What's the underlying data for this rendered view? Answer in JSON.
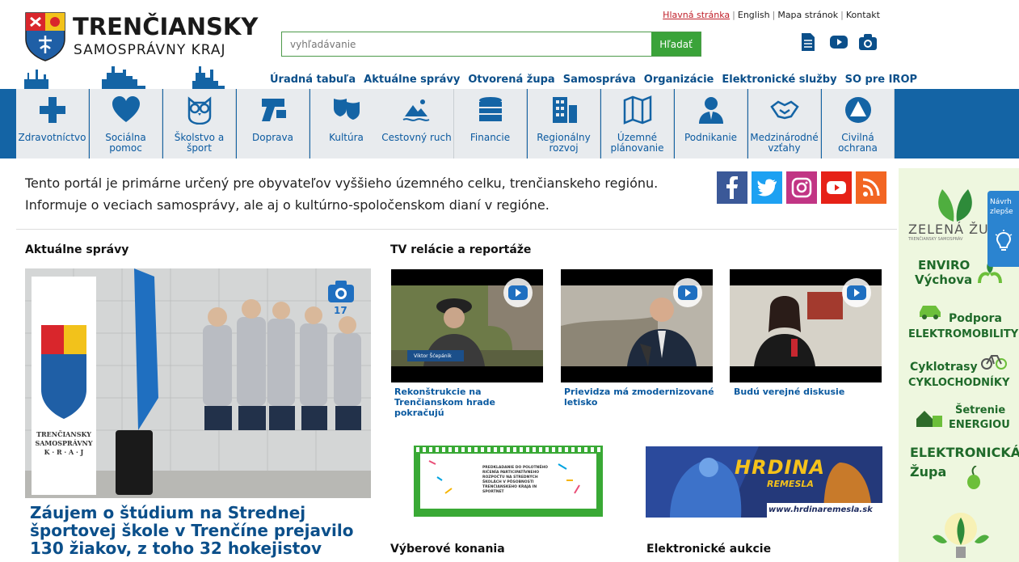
{
  "header": {
    "logo_line1": "TRENČIANSKY",
    "logo_line2": "SAMOSPRÁVNY KRAJ",
    "top_links": [
      "Hlavná stránka",
      "English",
      "Mapa stránok",
      "Kontakt"
    ],
    "search_placeholder": "vyhľadávanie",
    "search_button": "Hľadať",
    "icons": [
      "document-icon",
      "youtube-icon",
      "camera-icon"
    ]
  },
  "main_nav": [
    "Úradná tabuľa",
    "Aktuálne správy",
    "Otvorená župa",
    "Samospráva",
    "Organizácie",
    "Elektronické služby",
    "SO pre IROP"
  ],
  "categories": [
    {
      "label": "Zdravotníctvo",
      "icon": "cross-icon"
    },
    {
      "label": "Sociálna pomoc",
      "icon": "heart-icon"
    },
    {
      "label": "Školstvo a šport",
      "icon": "owl-icon"
    },
    {
      "label": "Doprava",
      "icon": "road-icon"
    },
    {
      "label": "Kultúra",
      "icon": "theater-masks-icon"
    },
    {
      "label": "Cestovný ruch",
      "icon": "tourism-icon"
    },
    {
      "label": "Financie",
      "icon": "coins-icon"
    },
    {
      "label": "Regionálny rozvoj",
      "icon": "buildings-icon"
    },
    {
      "label": "Územné plánovanie",
      "icon": "map-icon"
    },
    {
      "label": "Podnikanie",
      "icon": "businessman-icon"
    },
    {
      "label": "Medzinárodné vzťahy",
      "icon": "handshake-icon"
    },
    {
      "label": "Civilná ochrana",
      "icon": "civil-protection-icon"
    }
  ],
  "intro_text": "Tento portál je primárne určený pre obyvateľov vyššieho územného celku, trenčianskeho regiónu. Informuje o veciach samosprávy, ale aj o kultúrno-spoločenskom dianí v regióne.",
  "social": [
    "facebook-icon",
    "twitter-icon",
    "instagram-icon",
    "youtube-icon",
    "rss-icon"
  ],
  "news": {
    "heading": "Aktuálne správy",
    "photo_count": "17",
    "title": "Záujem o štúdium na Strednej športovej škole v Trenčíne prejavilo 130 žiakov, z toho 32 hokejistov",
    "banner_lines": [
      "TRENČIANSKY",
      "SAMOSPRÁVNY",
      "K · R · A · J"
    ]
  },
  "tv": {
    "heading": "TV relácie a reportáže",
    "videos": [
      {
        "title": "Rekonštrukcie na Trenčianskom hrade pokračujú",
        "caption": "Viktor Šćepánik"
      },
      {
        "title": "Prievidza má zmodernizované letisko"
      },
      {
        "title": "Budú verejné diskusie"
      }
    ]
  },
  "banners": {
    "hrdina_title": "HRDINA",
    "hrdina_sub": "REMESLA",
    "hrdina_url": "www.hrdinaremesla.sk",
    "poster_text": "PREDKLADANIE DO POLOTNÉHO RIČENÍA PARTICIPATÍVNEHO ROZPOČTU NA STREDNÝCH ŠKOLÁCH V PÔSOBNOSTI TRENČIANSKEHO KRAJA IN SPORTNET"
  },
  "sections": {
    "tenders": "Výberové konania",
    "auctions": "Elektronické aukcie"
  },
  "sidebar": {
    "zelena": "ZELENÁ ŽU",
    "zelena_sub": "TRENČIANSKY SAMOSPRÁV",
    "feedback": "Návrh zlepše",
    "enviro1": "ENVIRO",
    "enviro2": "Výchova",
    "podpora": "Podpora",
    "elektromobility": "ELEKTROMOBILITY",
    "cyklotrasy": "Cyklotrasy",
    "cyklochodniky": "CYKLOCHODNÍKY",
    "setrenie": "Šetrenie",
    "energiou": "ENERGIOU",
    "elektronicka": "ELEKTRONICKÁ",
    "zupa": "Župa"
  },
  "colors": {
    "brand_blue": "#1464a5",
    "link_blue": "#0b4f8a",
    "green": "#3aa339",
    "red": "#c0202a"
  }
}
